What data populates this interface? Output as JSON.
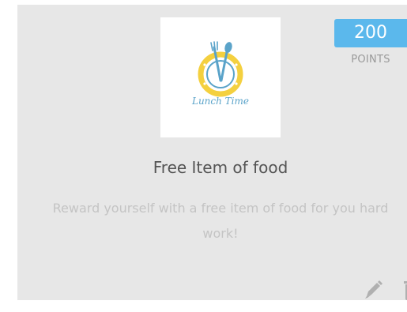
{
  "reward": {
    "logo_text": "Lunch Time",
    "points_value": "200",
    "points_label": "POINTS",
    "title": "Free Item of food",
    "description": "Reward yourself with a free item of food for you hard work!"
  },
  "icons": {
    "edit": "pencil-icon",
    "delete": "trash-icon",
    "logo": "plate-fork-spoon-icon"
  },
  "colors": {
    "card_bg": "#e7e7e7",
    "badge_bg": "#5bb8ec",
    "title": "#555555",
    "description": "#c4c4c4",
    "icon": "#b0b0b0",
    "logo_yellow": "#f4d03f",
    "logo_blue": "#5aa3c9"
  }
}
